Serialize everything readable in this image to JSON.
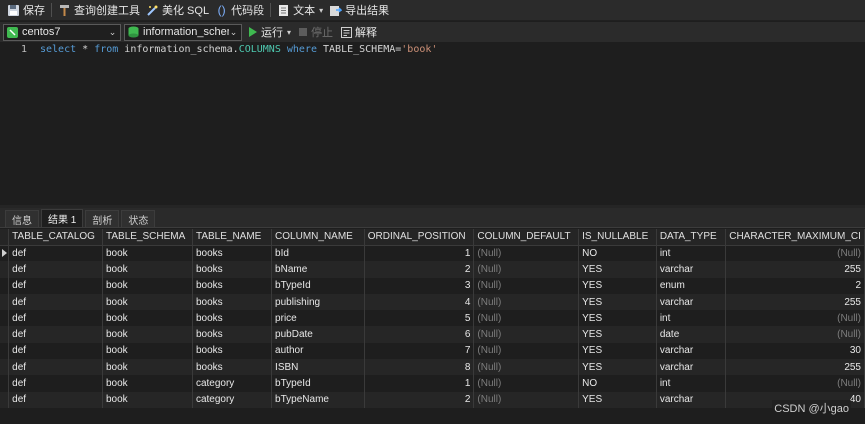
{
  "toolbar": {
    "save": "保存",
    "query_builder": "查询创建工具",
    "beautify_sql": "美化 SQL",
    "code_snippet": "代码段",
    "text": "文本",
    "export_result": "导出结果"
  },
  "toolbar2": {
    "connection": "centos7",
    "database": "information_schema",
    "run": "运行",
    "stop": "停止",
    "explain": "解释"
  },
  "editor": {
    "line_number": "1",
    "sql": {
      "select": "select",
      "star_from": " * ",
      "from": "from",
      "table": " information_schema.",
      "columns": "COLUMNS",
      "where": " where",
      "cond": " TABLE_SCHEMA=",
      "value": "'book'"
    }
  },
  "result_tabs": [
    "信息",
    "结果 1",
    "剖析",
    "状态"
  ],
  "grid": {
    "columns": [
      "TABLE_CATALOG",
      "TABLE_SCHEMA",
      "TABLE_NAME",
      "COLUMN_NAME",
      "ORDINAL_POSITION",
      "COLUMN_DEFAULT",
      "IS_NULLABLE",
      "DATA_TYPE",
      "CHARACTER_MAXIMUM_LENGTH"
    ],
    "header_visible": [
      "TABLE_CATALOG",
      "TABLE_SCHEMA",
      "TABLE_NAME",
      "COLUMN_NAME",
      "ORDINAL_POSITION",
      "COLUMN_DEFAULT",
      "IS_NULLABLE",
      "DATA_TYPE",
      "CHARACTER_MAXIMUM_CI"
    ],
    "rows": [
      [
        "def",
        "book",
        "books",
        "bId",
        "1",
        "(Null)",
        "NO",
        "int",
        "(Null)"
      ],
      [
        "def",
        "book",
        "books",
        "bName",
        "2",
        "(Null)",
        "YES",
        "varchar",
        "255"
      ],
      [
        "def",
        "book",
        "books",
        "bTypeId",
        "3",
        "(Null)",
        "YES",
        "enum",
        "2"
      ],
      [
        "def",
        "book",
        "books",
        "publishing",
        "4",
        "(Null)",
        "YES",
        "varchar",
        "255"
      ],
      [
        "def",
        "book",
        "books",
        "price",
        "5",
        "(Null)",
        "YES",
        "int",
        "(Null)"
      ],
      [
        "def",
        "book",
        "books",
        "pubDate",
        "6",
        "(Null)",
        "YES",
        "date",
        "(Null)"
      ],
      [
        "def",
        "book",
        "books",
        "author",
        "7",
        "(Null)",
        "YES",
        "varchar",
        "30"
      ],
      [
        "def",
        "book",
        "books",
        "ISBN",
        "8",
        "(Null)",
        "YES",
        "varchar",
        "255"
      ],
      [
        "def",
        "book",
        "category",
        "bTypeId",
        "1",
        "(Null)",
        "NO",
        "int",
        "(Null)"
      ],
      [
        "def",
        "book",
        "category",
        "bTypeName",
        "2",
        "(Null)",
        "YES",
        "varchar",
        "40"
      ]
    ]
  },
  "watermark": "CSDN @小gao",
  "colors": {
    "background": "#1e1e1e",
    "toolbar": "#2b2b2b",
    "keyword": "#569cd6",
    "string": "#ce9178",
    "null": "#7d7d7d",
    "run_icon": "#3fb950"
  },
  "icons": [
    "save-icon",
    "hammer-icon",
    "magic-wand-icon",
    "braces-icon",
    "document-icon",
    "export-icon",
    "connection-icon",
    "database-icon",
    "play-icon",
    "stop-icon",
    "explain-icon"
  ]
}
